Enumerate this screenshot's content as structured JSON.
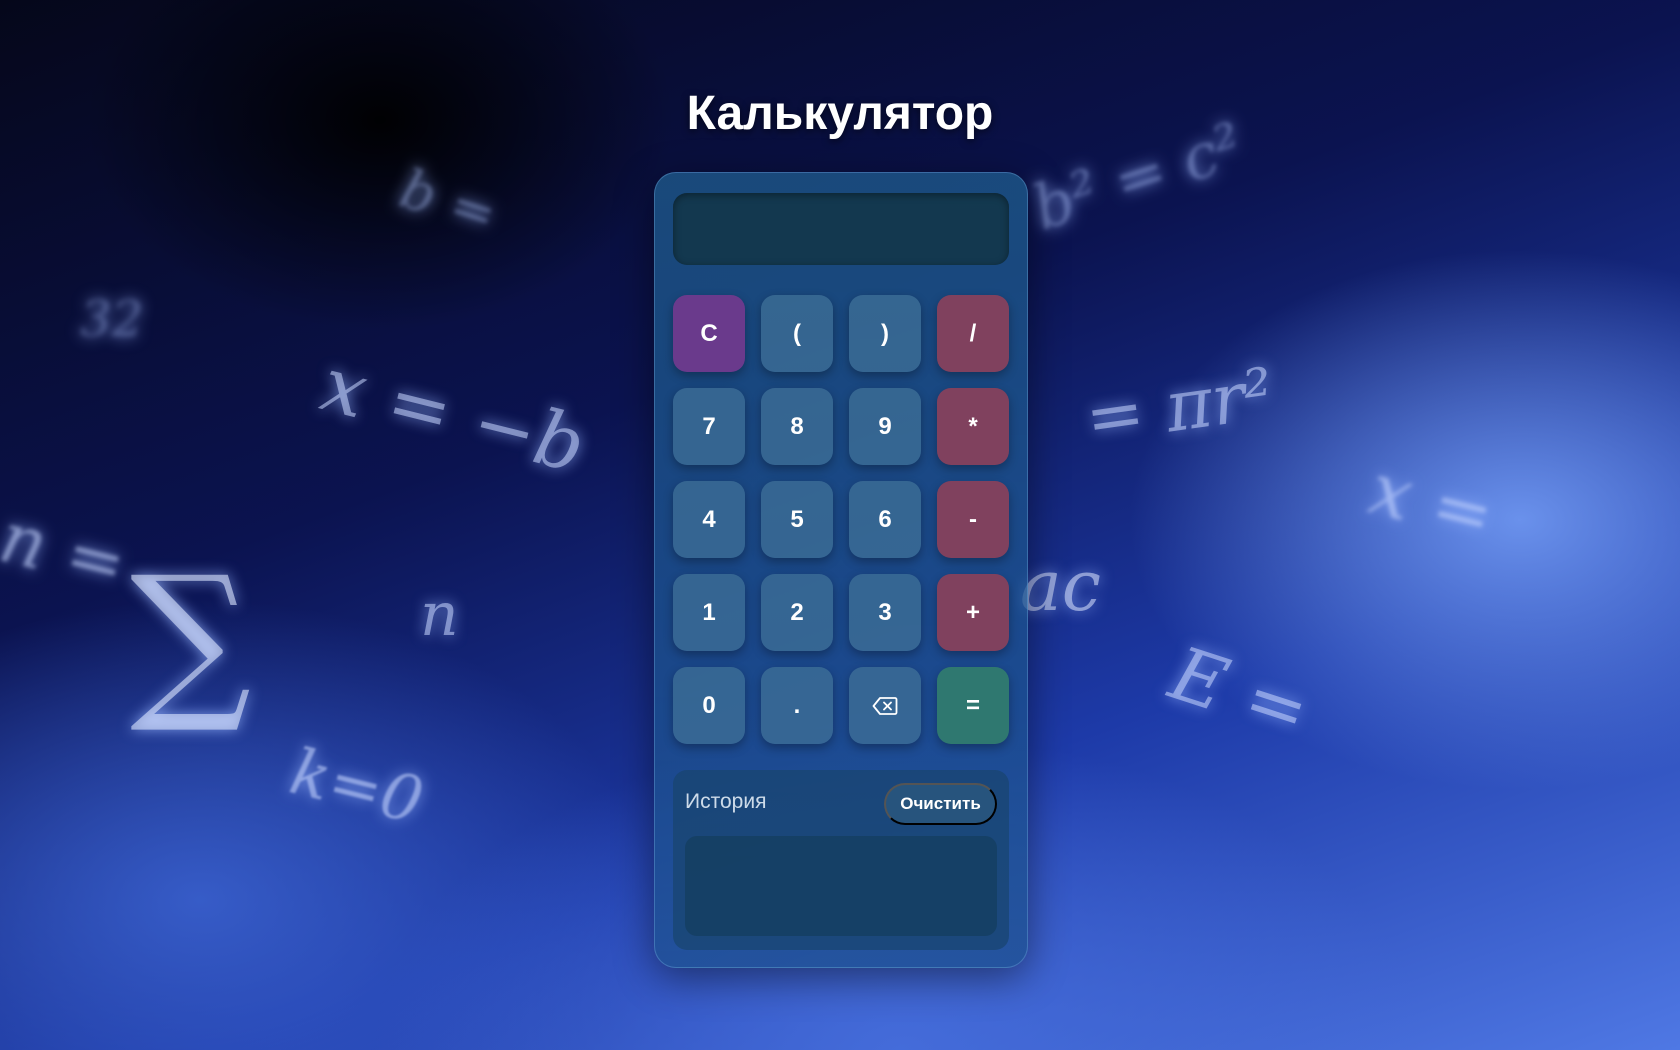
{
  "page": {
    "title": "Калькулятор"
  },
  "display": {
    "value": ""
  },
  "keypad": {
    "keys": [
      {
        "label": "C",
        "kind": "clear"
      },
      {
        "label": "(",
        "kind": "number"
      },
      {
        "label": ")",
        "kind": "number"
      },
      {
        "label": "/",
        "kind": "operator"
      },
      {
        "label": "7",
        "kind": "number"
      },
      {
        "label": "8",
        "kind": "number"
      },
      {
        "label": "9",
        "kind": "number"
      },
      {
        "label": "*",
        "kind": "operator"
      },
      {
        "label": "4",
        "kind": "number"
      },
      {
        "label": "5",
        "kind": "number"
      },
      {
        "label": "6",
        "kind": "number"
      },
      {
        "label": "-",
        "kind": "operator"
      },
      {
        "label": "1",
        "kind": "number"
      },
      {
        "label": "2",
        "kind": "number"
      },
      {
        "label": "3",
        "kind": "number"
      },
      {
        "label": "+",
        "kind": "operator"
      },
      {
        "label": "0",
        "kind": "number"
      },
      {
        "label": ".",
        "kind": "number"
      },
      {
        "label": "",
        "kind": "backspace",
        "icon": "backspace-icon"
      },
      {
        "label": "=",
        "kind": "equals"
      }
    ]
  },
  "history": {
    "title": "История",
    "clear_label": "Очистить",
    "items": []
  },
  "colors": {
    "clear_key": "#6a3a8c",
    "operator_key": "#80415e",
    "equals_key": "#2f7870",
    "number_key": "#3e6e96"
  }
}
